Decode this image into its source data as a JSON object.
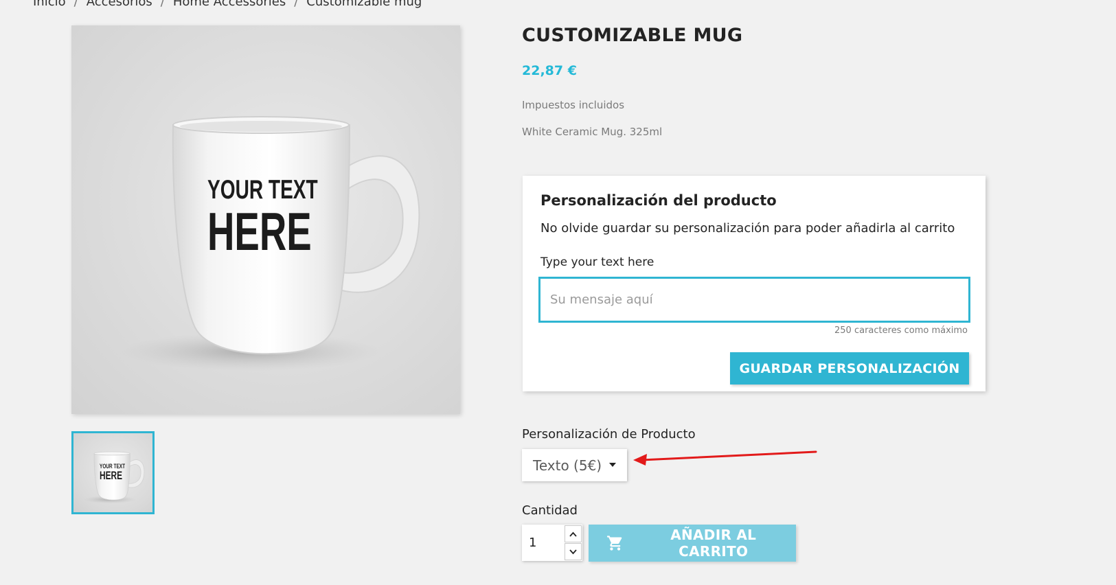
{
  "breadcrumb": {
    "items": [
      "Inicio",
      "Accesorios",
      "Home Accessories",
      "Customizable mug"
    ],
    "separator": "/"
  },
  "product": {
    "image_text_line1": "YOUR TEXT",
    "image_text_line2": "HERE",
    "title": "CUSTOMIZABLE MUG",
    "price": "22,87 €",
    "tax_note": "Impuestos incluidos",
    "short_description": "White Ceramic Mug. 325ml"
  },
  "customization": {
    "title": "Personalización del producto",
    "note": "No olvide guardar su personalización para poder añadirla al carrito",
    "field_label": "Type your text here",
    "placeholder": "Su mensaje aquí",
    "char_limit": "250 caracteres como máximo",
    "save_button": "GUARDAR PERSONALIZACIÓN"
  },
  "variant": {
    "label": "Personalización de Producto",
    "selected": "Texto (5€)"
  },
  "quantity": {
    "label": "Cantidad",
    "value": "1"
  },
  "cart_button": "AÑADIR AL CARRITO",
  "colors": {
    "accent": "#2fb5d2",
    "price": "#24b9d7",
    "annotation_arrow": "#e21a1a",
    "cart_button": "#7ccde0"
  },
  "icons": {
    "cart": "shopping-cart-icon",
    "select_caret": "caret-down-icon",
    "qty_up": "chevron-up-icon",
    "qty_down": "chevron-down-icon"
  }
}
